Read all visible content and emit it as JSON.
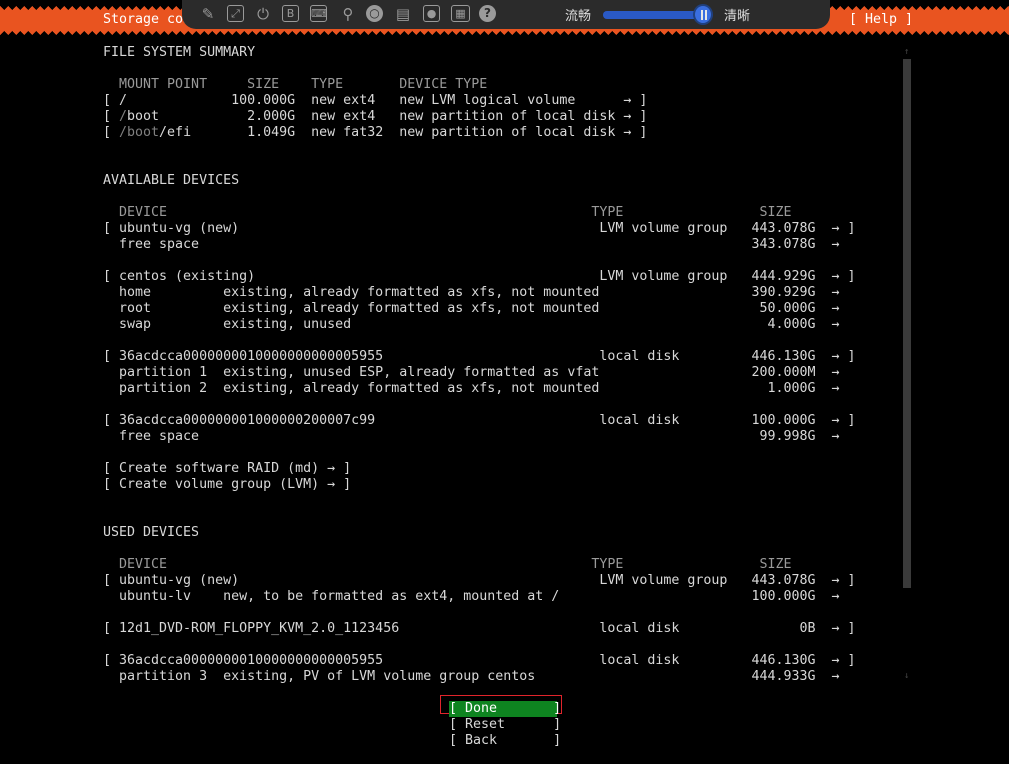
{
  "header": {
    "title": "Storage con",
    "help": "[ Help ]"
  },
  "toolbar": {
    "icons": [
      "pin-icon",
      "fullscreen-icon",
      "power-icon",
      "b-icon",
      "keyboard-icon",
      "mouse-icon",
      "disc-icon",
      "save-icon",
      "record-icon",
      "keyboard-layout-icon",
      "help-icon"
    ],
    "quality_left": "流畅",
    "quality_right": "清晰",
    "quality_level": 0.9
  },
  "fs_summary": {
    "title": "FILE SYSTEM SUMMARY",
    "header": "  MOUNT POINT     SIZE    TYPE       DEVICE TYPE",
    "rows": [
      {
        "prefix": "[ ",
        "mount_dim": "",
        "mount": "/",
        "rest": "             100.000G  new ext4   new LVM logical volume      → ]"
      },
      {
        "prefix": "[ ",
        "mount_dim": "/",
        "mount": "boot",
        "rest": "           2.000G  new ext4   new partition of local disk → ]"
      },
      {
        "prefix": "[ ",
        "mount_dim": "/boot",
        "mount": "/efi",
        "rest": "       1.049G  new fat32  new partition of local disk → ]"
      }
    ]
  },
  "available": {
    "title": "AVAILABLE DEVICES",
    "header": "  DEVICE                                                     TYPE                 SIZE",
    "lines": [
      "[ ubuntu-vg (new)                                             LVM volume group   443.078G  → ]",
      "  free space                                                                     343.078G  →",
      "",
      "[ centos (existing)                                           LVM volume group   444.929G  → ]",
      "  home         existing, already formatted as xfs, not mounted                   390.929G  →",
      "  root         existing, already formatted as xfs, not mounted                    50.000G  →",
      "  swap         existing, unused                                                    4.000G  →",
      "",
      "[ 36acdcca0000000010000000000005955                           local disk         446.130G  → ]",
      "  partition 1  existing, unused ESP, already formatted as vfat                   200.000M  →",
      "  partition 2  existing, already formatted as xfs, not mounted                     1.000G  →",
      "",
      "[ 36acdcca000000001000000200007c99                            local disk         100.000G  → ]",
      "  free space                                                                      99.998G  →",
      "",
      "[ Create software RAID (md) → ]",
      "[ Create volume group (LVM) → ]"
    ]
  },
  "used": {
    "title": "USED DEVICES",
    "header": "  DEVICE                                                     TYPE                 SIZE",
    "lines": [
      "[ ubuntu-vg (new)                                             LVM volume group   443.078G  → ]",
      "  ubuntu-lv    new, to be formatted as ext4, mounted at /                        100.000G  →",
      "",
      "[ 12d1_DVD-ROM_FLOPPY_KVM_2.0_1123456                         local disk               0B  → ]",
      "",
      "[ 36acdcca0000000010000000000005955                           local disk         446.130G  → ]",
      "  partition 3  existing, PV of LVM volume group centos                           444.933G  →"
    ]
  },
  "buttons": {
    "done": "[ Done       ]",
    "reset": "[ Reset      ]",
    "back": "[ Back       ]"
  },
  "scroll": {
    "up": "↑",
    "down": "↓"
  }
}
